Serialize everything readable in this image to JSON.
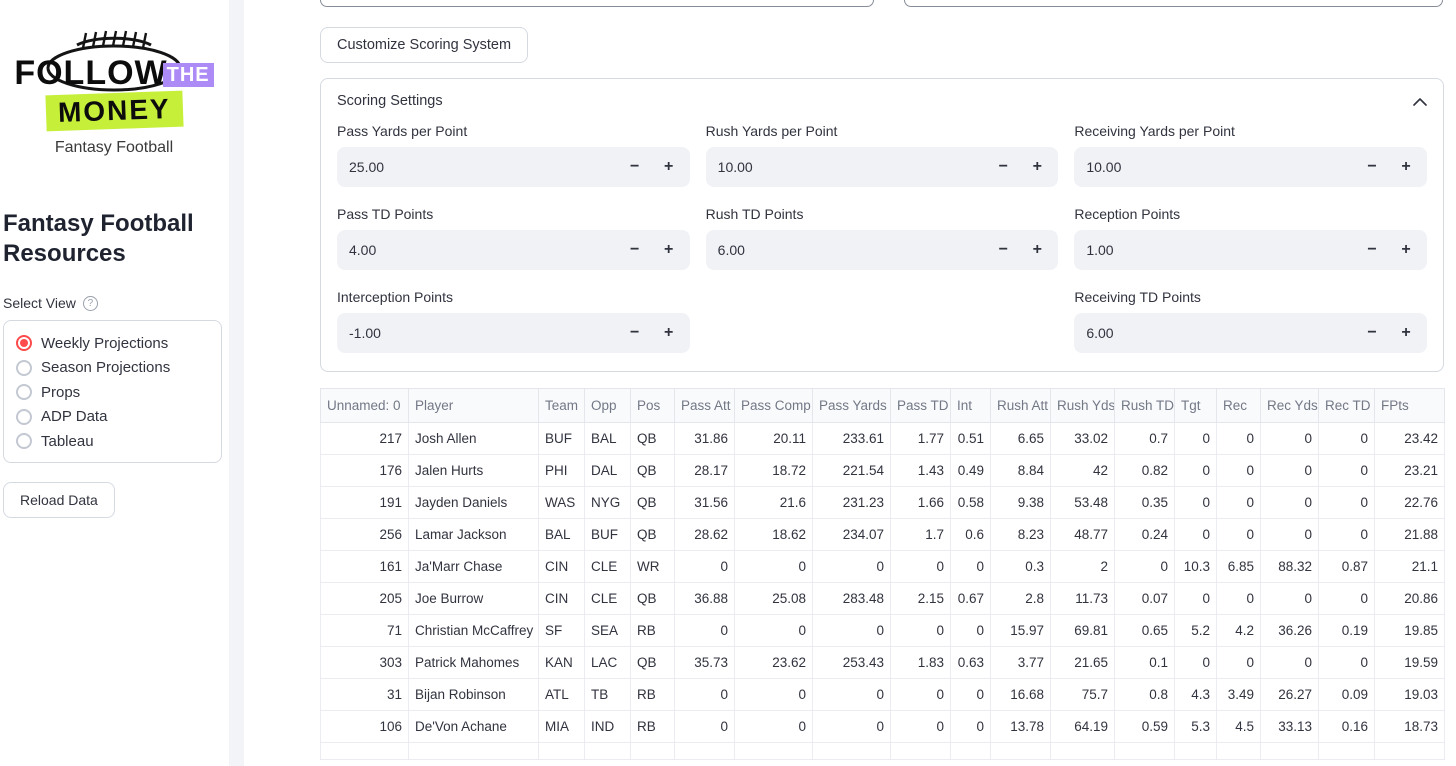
{
  "colors": {
    "accent_red": "#ff4b4b",
    "logo_purple": "#ad8bf7",
    "logo_lime": "#c6ef3a"
  },
  "sidebar": {
    "logo": {
      "follow": "FOLLOW",
      "the": "THE",
      "money": "MONEY",
      "subtitle": "Fantasy Football",
      "football_icon": "football-icon"
    },
    "title": "Fantasy Football Resources",
    "select_view_label": "Select View",
    "help_icon": "?",
    "options": [
      {
        "label": "Weekly Projections",
        "selected": true
      },
      {
        "label": "Season Projections",
        "selected": false
      },
      {
        "label": "Props",
        "selected": false
      },
      {
        "label": "ADP Data",
        "selected": false
      },
      {
        "label": "Tableau",
        "selected": false
      }
    ],
    "reload_button": "Reload Data"
  },
  "main": {
    "customize_button": "Customize Scoring System",
    "scoring": {
      "title": "Scoring Settings",
      "minus": "−",
      "plus": "+",
      "rows": [
        [
          {
            "label": "Pass Yards per Point",
            "value": "25.00"
          },
          {
            "label": "Rush Yards per Point",
            "value": "10.00"
          },
          {
            "label": "Receiving Yards per Point",
            "value": "10.00"
          }
        ],
        [
          {
            "label": "Pass TD Points",
            "value": "4.00"
          },
          {
            "label": "Rush TD Points",
            "value": "6.00"
          },
          {
            "label": "Reception Points",
            "value": "1.00"
          }
        ],
        [
          {
            "label": "Interception Points",
            "value": "-1.00"
          },
          null,
          {
            "label": "Receiving TD Points",
            "value": "6.00"
          }
        ]
      ]
    },
    "table": {
      "columns": [
        "Unnamed: 0",
        "Player",
        "Team",
        "Opp",
        "Pos",
        "Pass Att",
        "Pass Comp",
        "Pass Yards",
        "Pass TD",
        "Int",
        "Rush Att",
        "Rush Yds",
        "Rush TD",
        "Tgt",
        "Rec",
        "Rec Yds",
        "Rec TD",
        "FPts"
      ],
      "rows": [
        [
          "217",
          "Josh Allen",
          "BUF",
          "BAL",
          "QB",
          "31.86",
          "20.11",
          "233.61",
          "1.77",
          "0.51",
          "6.65",
          "33.02",
          "0.7",
          "0",
          "0",
          "0",
          "0",
          "23.42"
        ],
        [
          "176",
          "Jalen Hurts",
          "PHI",
          "DAL",
          "QB",
          "28.17",
          "18.72",
          "221.54",
          "1.43",
          "0.49",
          "8.84",
          "42",
          "0.82",
          "0",
          "0",
          "0",
          "0",
          "23.21"
        ],
        [
          "191",
          "Jayden Daniels",
          "WAS",
          "NYG",
          "QB",
          "31.56",
          "21.6",
          "231.23",
          "1.66",
          "0.58",
          "9.38",
          "53.48",
          "0.35",
          "0",
          "0",
          "0",
          "0",
          "22.76"
        ],
        [
          "256",
          "Lamar Jackson",
          "BAL",
          "BUF",
          "QB",
          "28.62",
          "18.62",
          "234.07",
          "1.7",
          "0.6",
          "8.23",
          "48.77",
          "0.24",
          "0",
          "0",
          "0",
          "0",
          "21.88"
        ],
        [
          "161",
          "Ja'Marr Chase",
          "CIN",
          "CLE",
          "WR",
          "0",
          "0",
          "0",
          "0",
          "0",
          "0.3",
          "2",
          "0",
          "10.3",
          "6.85",
          "88.32",
          "0.87",
          "21.1"
        ],
        [
          "205",
          "Joe Burrow",
          "CIN",
          "CLE",
          "QB",
          "36.88",
          "25.08",
          "283.48",
          "2.15",
          "0.67",
          "2.8",
          "11.73",
          "0.07",
          "0",
          "0",
          "0",
          "0",
          "20.86"
        ],
        [
          "71",
          "Christian McCaffrey",
          "SF",
          "SEA",
          "RB",
          "0",
          "0",
          "0",
          "0",
          "0",
          "15.97",
          "69.81",
          "0.65",
          "5.2",
          "4.2",
          "36.26",
          "0.19",
          "19.85"
        ],
        [
          "303",
          "Patrick Mahomes",
          "KAN",
          "LAC",
          "QB",
          "35.73",
          "23.62",
          "253.43",
          "1.83",
          "0.63",
          "3.77",
          "21.65",
          "0.1",
          "0",
          "0",
          "0",
          "0",
          "19.59"
        ],
        [
          "31",
          "Bijan Robinson",
          "ATL",
          "TB",
          "RB",
          "0",
          "0",
          "0",
          "0",
          "0",
          "16.68",
          "75.7",
          "0.8",
          "4.3",
          "3.49",
          "26.27",
          "0.09",
          "19.03"
        ],
        [
          "106",
          "De'Von Achane",
          "MIA",
          "IND",
          "RB",
          "0",
          "0",
          "0",
          "0",
          "0",
          "13.78",
          "64.19",
          "0.59",
          "5.3",
          "4.5",
          "33.13",
          "0.16",
          "18.73"
        ]
      ],
      "partial_row_visible": true
    }
  }
}
